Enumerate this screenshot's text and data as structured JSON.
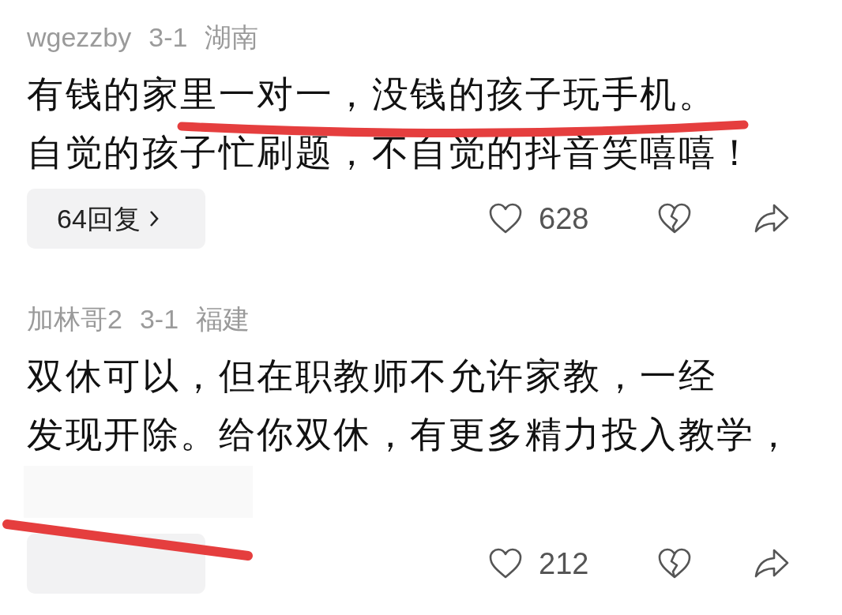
{
  "comments": [
    {
      "user": "wgezzby",
      "date": "3-1",
      "location": "湖南",
      "text_lines": [
        "有钱的家里一对一，没钱的孩子玩手机。",
        "自觉的孩子忙刷题，不自觉的抖音笑嘻嘻！"
      ],
      "reply_label": "64回复",
      "likes": "628"
    },
    {
      "user": "加林哥2",
      "date": "3-1",
      "location": "福建",
      "text_lines": [
        "双休可以，但在职教师不允许家教，一经",
        "发现开除。给你双休，有更多精力投入教学，"
      ],
      "likes": "212"
    }
  ]
}
